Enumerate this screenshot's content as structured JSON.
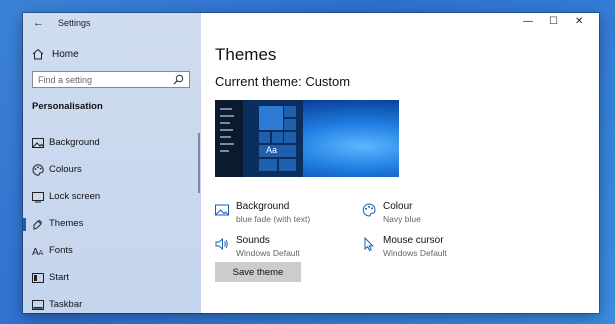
{
  "window": {
    "title": "Settings",
    "controls": {
      "minimize": "—",
      "maximize": "☐",
      "close": "✕"
    }
  },
  "sidebar": {
    "home_label": "Home",
    "search_placeholder": "Find a setting",
    "section_title": "Personalisation",
    "items": [
      {
        "label": "Background",
        "icon": "picture-icon"
      },
      {
        "label": "Colours",
        "icon": "palette-icon"
      },
      {
        "label": "Lock screen",
        "icon": "lock-screen-icon"
      },
      {
        "label": "Themes",
        "icon": "themes-icon",
        "active": true
      },
      {
        "label": "Fonts",
        "icon": "font-icon"
      },
      {
        "label": "Start",
        "icon": "start-icon"
      },
      {
        "label": "Taskbar",
        "icon": "taskbar-icon"
      }
    ]
  },
  "main": {
    "title": "Themes",
    "current_theme": "Current theme: Custom",
    "preview_text": "Aa",
    "props": {
      "background": {
        "title": "Background",
        "sub": "blue fade (with text)"
      },
      "colour": {
        "title": "Colour",
        "sub": "Navy blue"
      },
      "sounds": {
        "title": "Sounds",
        "sub": "Windows Default"
      },
      "cursor": {
        "title": "Mouse cursor",
        "sub": "Windows Default"
      }
    },
    "save_label": "Save theme"
  },
  "colors": {
    "accent": "#1a5fb4",
    "desktop": "#3b82d6",
    "sidebar": "#cfdcf0"
  }
}
